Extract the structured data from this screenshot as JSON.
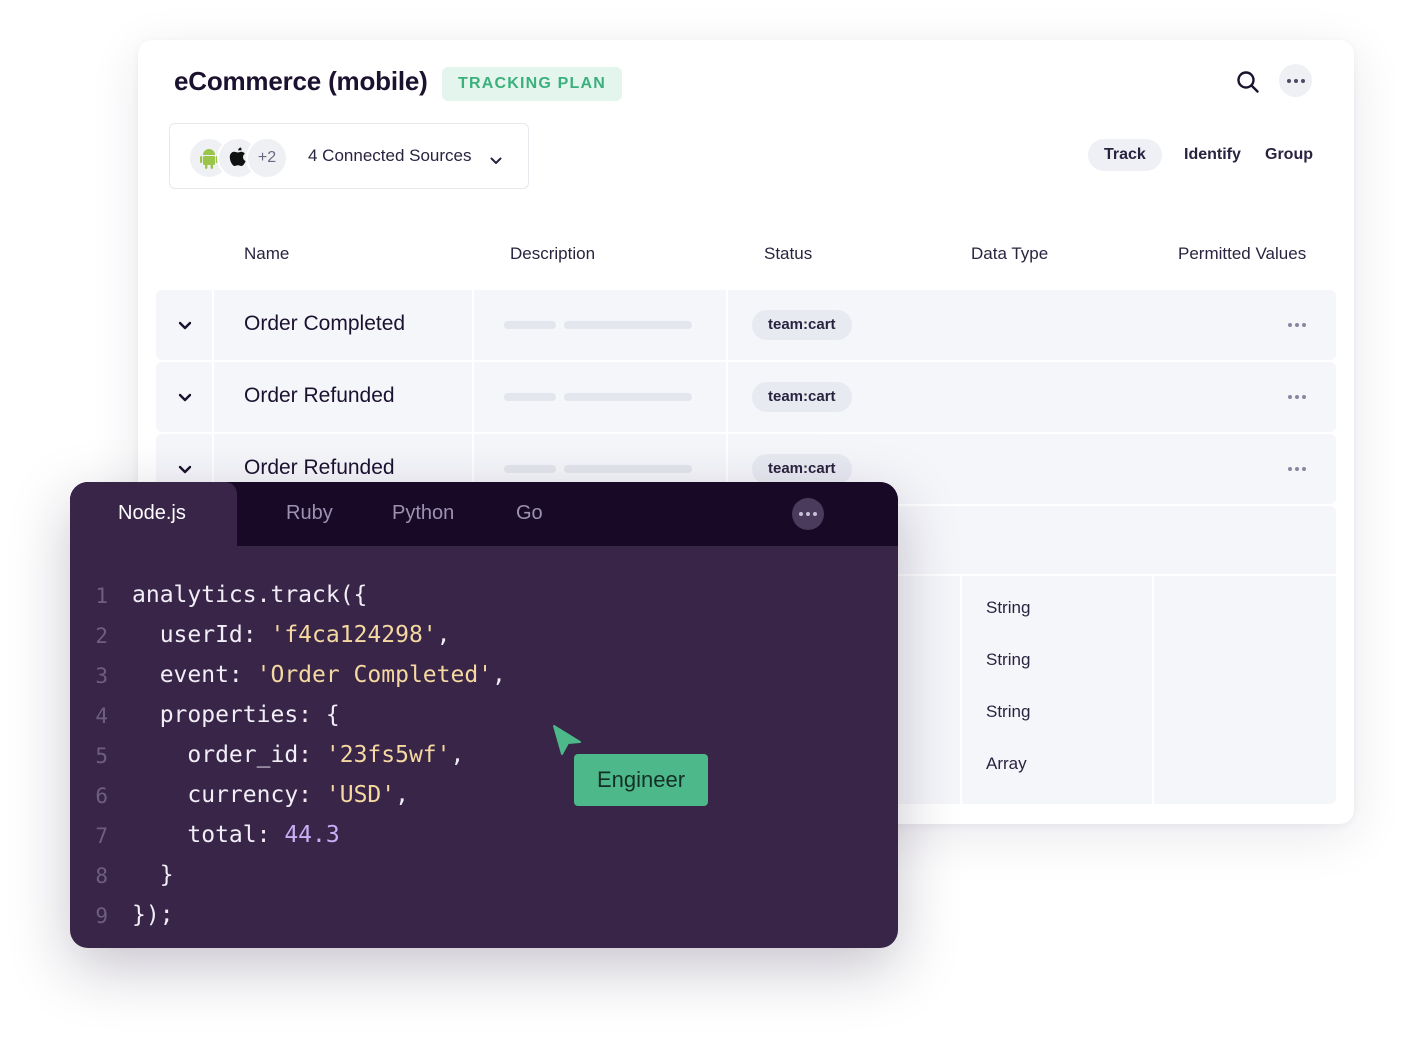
{
  "header": {
    "title": "eCommerce (mobile)",
    "badge": "TRACKING PLAN"
  },
  "sources": {
    "extra_count": "+2",
    "label": "4 Connected Sources",
    "icons": [
      "android-icon",
      "apple-icon"
    ]
  },
  "segments": {
    "track": "Track",
    "identify": "Identify",
    "group": "Group",
    "active": "Track"
  },
  "table": {
    "columns": [
      "Name",
      "Description",
      "Status",
      "Data Type",
      "Permitted Values"
    ],
    "rows": [
      {
        "name": "Order Completed",
        "status": "team:cart"
      },
      {
        "name": "Order Refunded",
        "status": "team:cart"
      },
      {
        "name": "Order Refunded",
        "status": "team:cart"
      }
    ],
    "data_types": [
      "String",
      "String",
      "String",
      "Array"
    ]
  },
  "code_panel": {
    "tabs": [
      "Node.js",
      "Ruby",
      "Python",
      "Go"
    ],
    "active_tab": "Node.js",
    "line_numbers": [
      "1",
      "2",
      "3",
      "4",
      "5",
      "6",
      "7",
      "8",
      "9"
    ],
    "lines": {
      "l1": "analytics.track({",
      "l2_key": "  userId: ",
      "l2_val": "'f4ca124298'",
      "l2_end": ",",
      "l3_key": "  event: ",
      "l3_val": "'Order Completed'",
      "l3_end": ",",
      "l4": "  properties: {",
      "l5_key": "    order_id: ",
      "l5_val": "'23fs5wf'",
      "l5_end": ",",
      "l6_key": "    currency: ",
      "l6_val": "'USD'",
      "l6_end": ",",
      "l7_key": "    total: ",
      "l7_val": "44.3",
      "l8": "  }",
      "l9": "});"
    }
  },
  "cursor_label": "Engineer",
  "colors": {
    "accent_green": "#4db889",
    "badge_bg": "#e3f5ec",
    "code_bg": "#382548",
    "code_tabbar": "#180a26"
  }
}
